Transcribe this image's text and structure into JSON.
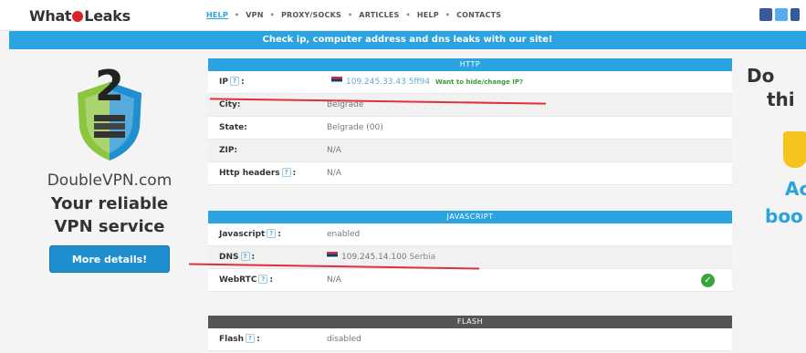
{
  "header": {
    "logo_text_left": "What",
    "logo_text_right": "Leaks",
    "nav": [
      {
        "label": "HELP",
        "active": true
      },
      {
        "label": "VPN"
      },
      {
        "label": "PROXY/SOCKS"
      },
      {
        "label": "ARTICLES"
      },
      {
        "label": "HELP"
      },
      {
        "label": "CONTACTS"
      }
    ],
    "social": [
      "facebook-icon",
      "twitter-icon",
      "googleplus-icon"
    ]
  },
  "banner": "Check ip, computer address and dns leaks with our site!",
  "ad_left": {
    "tagline_brand": "DoubleVPN.com",
    "tagline_line2": "Your reliable",
    "tagline_line3": "VPN service",
    "button": "More details!"
  },
  "sections": {
    "http": {
      "title": "HTTP",
      "rows": {
        "ip_label": "IP",
        "ip_value": "109.245.33.43 5ff94",
        "ip_link": "Want to hide/change IP?",
        "city_label": "City:",
        "city_value": "Belgrade",
        "state_label": "State:",
        "state_value": "Belgrade (00)",
        "zip_label": "ZIP:",
        "zip_value": "N/A",
        "headers_label": "Http headers",
        "headers_value": "N/A"
      }
    },
    "javascript": {
      "title": "JAVASCRIPT",
      "rows": {
        "js_label": "Javascript",
        "js_value": "enabled",
        "dns_label": "DNS",
        "dns_value": "109.245.14.100",
        "dns_country": "Serbia",
        "webrtc_label": "WebRTC",
        "webrtc_value": "N/A"
      }
    },
    "flash": {
      "title": "FLASH",
      "rows": {
        "flash_label": "Flash",
        "flash_value": "disabled"
      }
    }
  },
  "ad_right": {
    "line1": "Do",
    "line2": "thi",
    "line3": "Ac",
    "line4": "boo"
  },
  "colors": {
    "accent": "#2aa3e0",
    "annotation": "#e0313a",
    "success": "#3aa33a"
  }
}
